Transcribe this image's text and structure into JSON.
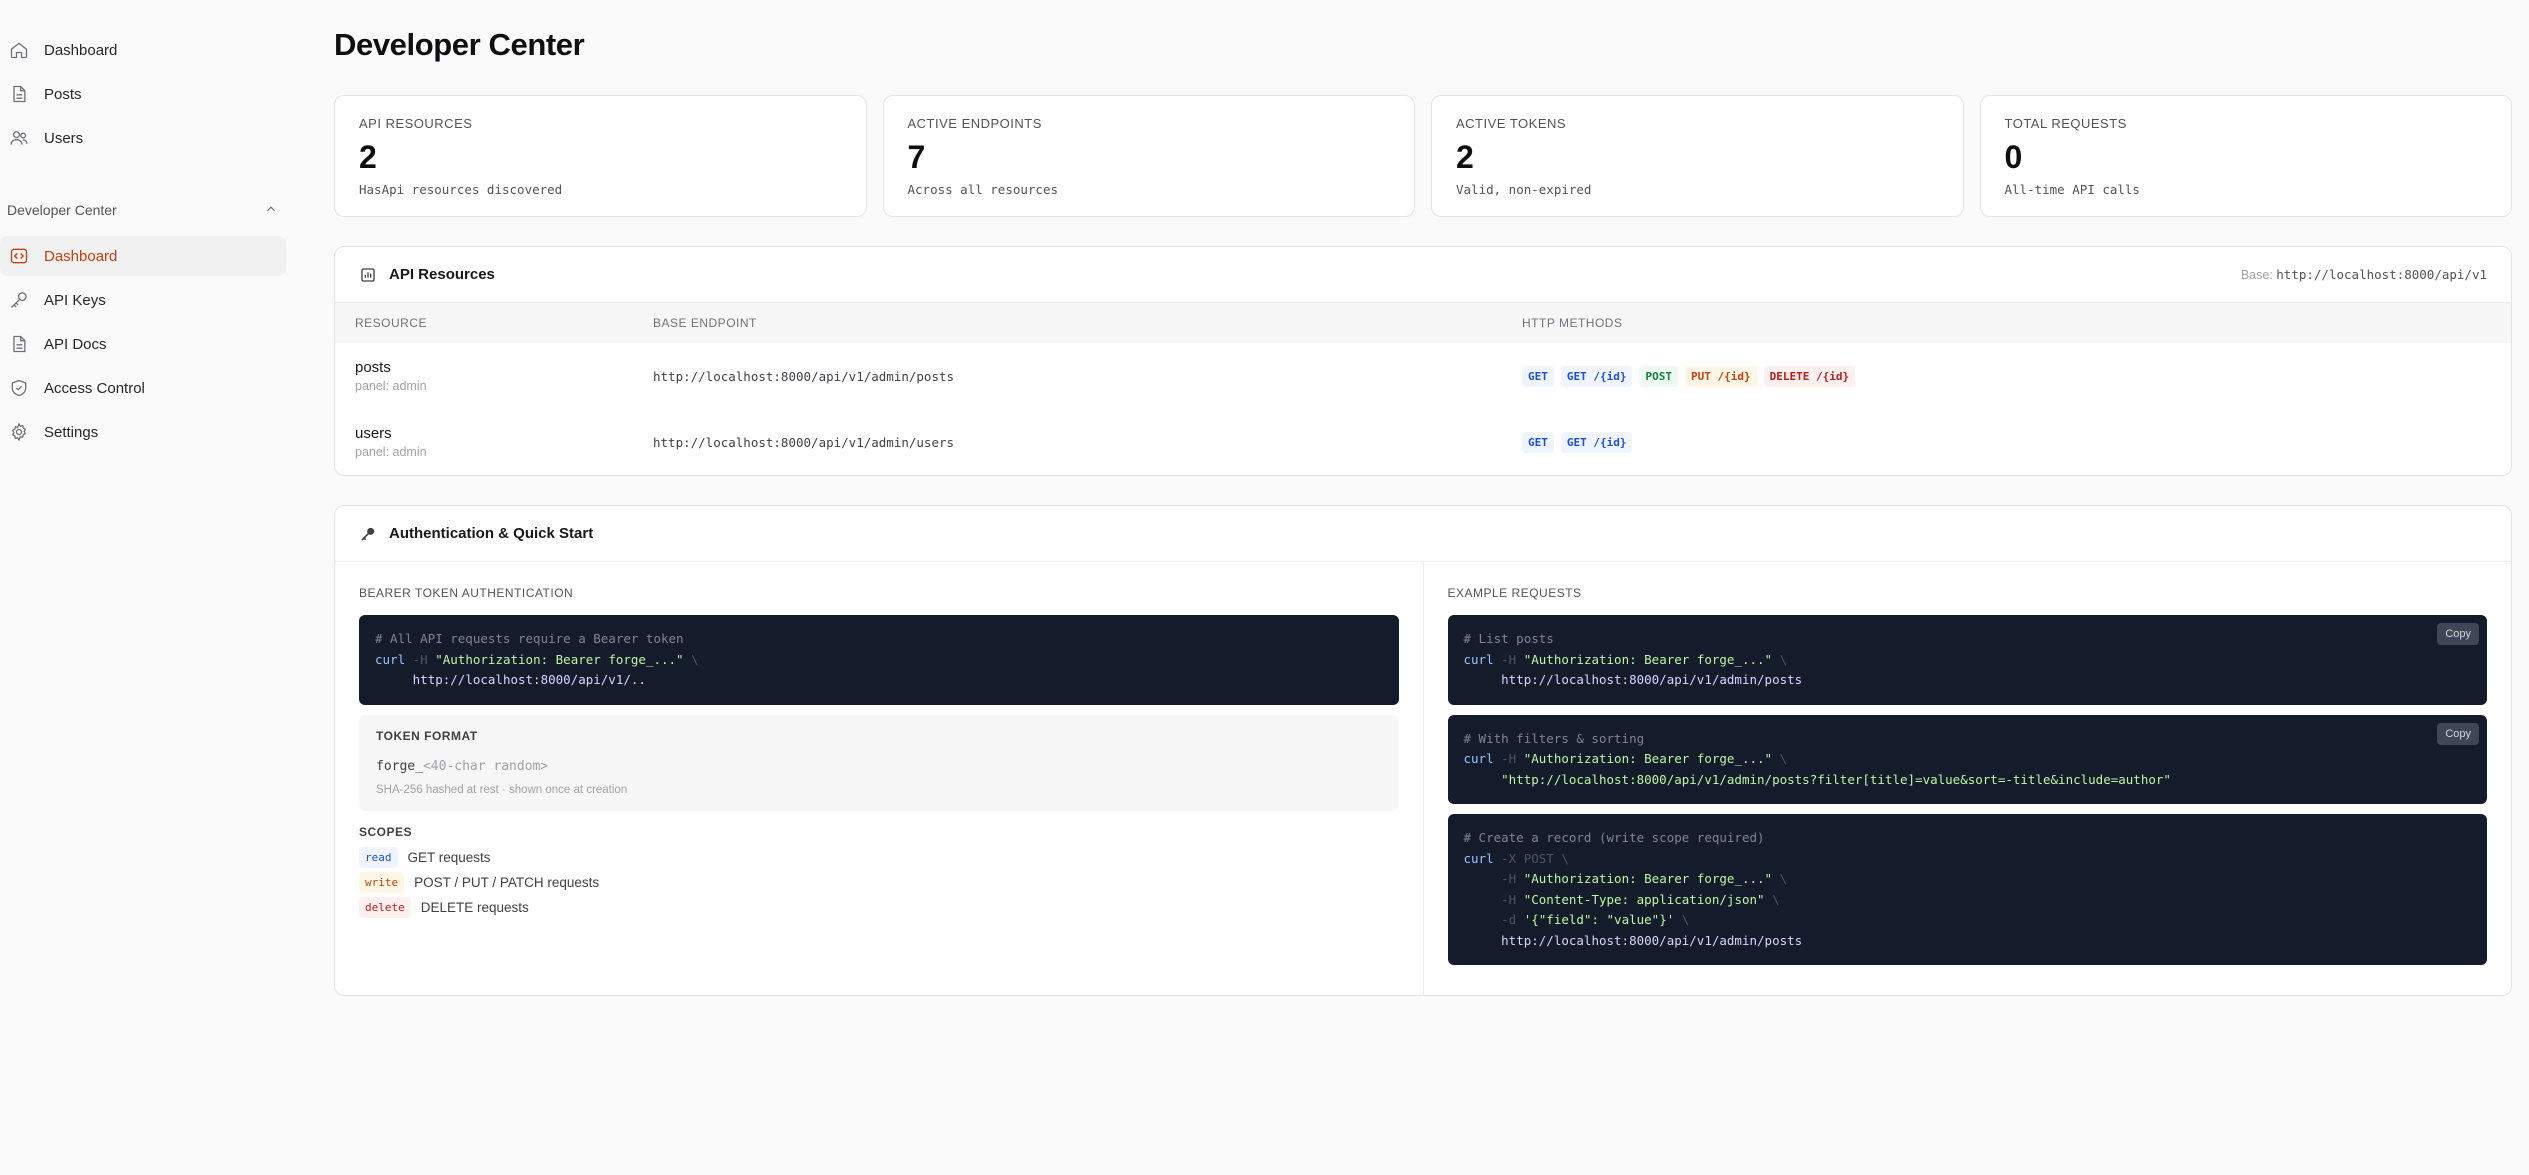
{
  "sidebar": {
    "top_items": [
      {
        "label": "Dashboard",
        "icon": "home-icon"
      },
      {
        "label": "Posts",
        "icon": "document-icon"
      },
      {
        "label": "Users",
        "icon": "users-icon"
      }
    ],
    "group": {
      "title": "Developer Center",
      "items": [
        {
          "label": "Dashboard",
          "icon": "code-icon",
          "active": true
        },
        {
          "label": "API Keys",
          "icon": "key-icon"
        },
        {
          "label": "API Docs",
          "icon": "document-icon"
        },
        {
          "label": "Access Control",
          "icon": "shield-icon"
        },
        {
          "label": "Settings",
          "icon": "gear-icon"
        }
      ]
    }
  },
  "page": {
    "title": "Developer Center"
  },
  "stats": [
    {
      "label": "API RESOURCES",
      "value": "2",
      "sub": "HasApi resources discovered"
    },
    {
      "label": "ACTIVE ENDPOINTS",
      "value": "7",
      "sub": "Across all resources"
    },
    {
      "label": "ACTIVE TOKENS",
      "value": "2",
      "sub": "Valid, non-expired"
    },
    {
      "label": "TOTAL REQUESTS",
      "value": "0",
      "sub": "All-time API calls"
    }
  ],
  "resources": {
    "title": "API Resources",
    "base_label": "Base:",
    "base_url": "http://localhost:8000/api/v1",
    "columns": [
      "RESOURCE",
      "BASE ENDPOINT",
      "HTTP METHODS"
    ],
    "rows": [
      {
        "name": "posts",
        "panel": "panel: admin",
        "endpoint": "http://localhost:8000/api/v1/admin/posts",
        "methods": [
          "GET",
          "GET /{id}",
          "POST",
          "PUT /{id}",
          "DELETE /{id}"
        ]
      },
      {
        "name": "users",
        "panel": "panel: admin",
        "endpoint": "http://localhost:8000/api/v1/admin/users",
        "methods": [
          "GET",
          "GET /{id}"
        ]
      }
    ]
  },
  "auth": {
    "title": "Authentication & Quick Start",
    "left_label": "BEARER TOKEN AUTHENTICATION",
    "bearer_code": {
      "comment": "# All API requests require a Bearer token",
      "cmd": "curl",
      "flag": "-H",
      "header": "\"Authorization: Bearer forge_...\"",
      "cont": "\\",
      "url": "http://localhost:8000/api/v1/.."
    },
    "token_format_title": "TOKEN FORMAT",
    "token_prefix": "forge_",
    "token_rest": "<40-char random>",
    "token_note": "SHA-256 hashed at rest · shown once at creation",
    "scopes_title": "SCOPES",
    "scopes": [
      {
        "badge": "read",
        "desc": "GET requests"
      },
      {
        "badge": "write",
        "desc": "POST / PUT / PATCH requests"
      },
      {
        "badge": "delete",
        "desc": "DELETE requests"
      }
    ],
    "right_label": "EXAMPLE REQUESTS",
    "copy_label": "Copy",
    "ex1": {
      "comment": "# List posts",
      "cmd": "curl",
      "flag": "-H",
      "header": "\"Authorization: Bearer forge_...\"",
      "cont": "\\",
      "url": "http://localhost:8000/api/v1/admin/posts"
    },
    "ex2": {
      "comment": "# With filters & sorting",
      "cmd": "curl",
      "flag": "-H",
      "header": "\"Authorization: Bearer forge_...\"",
      "cont": "\\",
      "url": "\"http://localhost:8000/api/v1/admin/posts?filter[title]=value&sort=-title&include=author\""
    },
    "ex3": {
      "comment": "# Create a record (write scope required)",
      "cmd": "curl",
      "method_flag": "-X POST",
      "cont": "\\",
      "flag": "-H",
      "header1": "\"Authorization: Bearer forge_...\"",
      "header2": "\"Content-Type: application/json\"",
      "data_flag": "-d",
      "data": "'{\"field\": \"value\"}'",
      "url": "http://localhost:8000/api/v1/admin/posts"
    }
  },
  "colors": {
    "accent": "#c2410c",
    "code_bg": "#141b2b"
  }
}
